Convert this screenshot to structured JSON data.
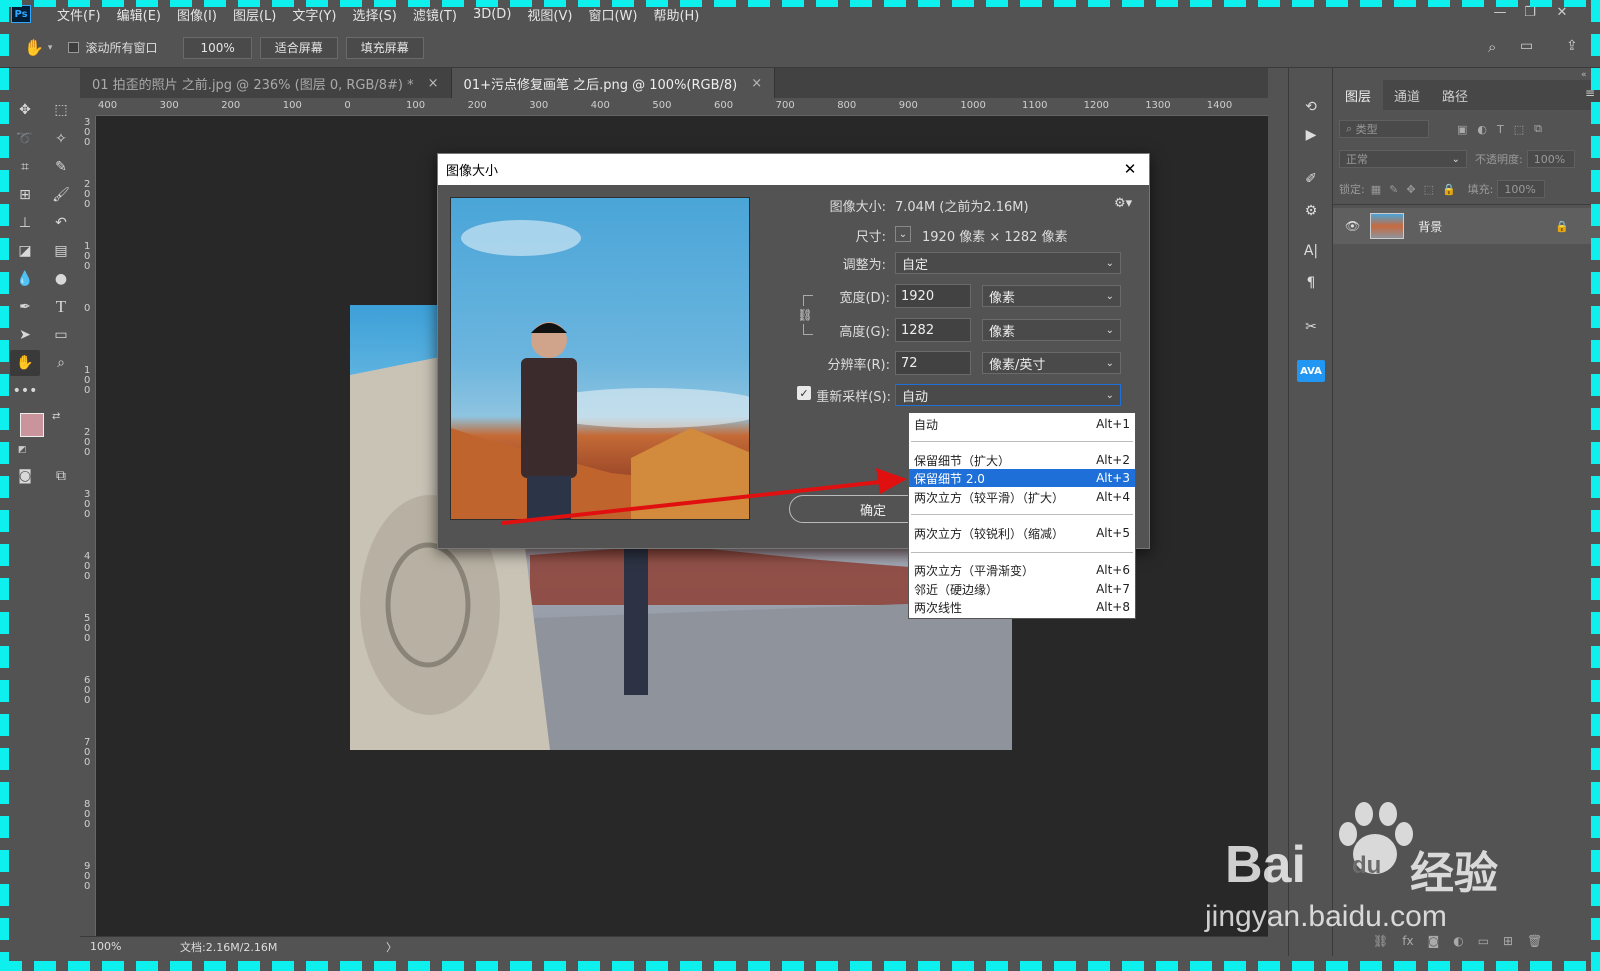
{
  "menubar": {
    "logo": "Ps",
    "items": [
      "文件(F)",
      "编辑(E)",
      "图像(I)",
      "图层(L)",
      "文字(Y)",
      "选择(S)",
      "滤镜(T)",
      "3D(D)",
      "视图(V)",
      "窗口(W)",
      "帮助(H)"
    ]
  },
  "options": {
    "scroll_all_label": "滚动所有窗口",
    "zoom_value": "100%",
    "fit_screen": "适合屏幕",
    "fill_screen": "填充屏幕"
  },
  "tabs": [
    {
      "label": "01 拍歪的照片 之前.jpg @ 236% (图层 0, RGB/8#) *",
      "close": "×"
    },
    {
      "label": "01+污点修复画笔 之后.png @ 100%(RGB/8)",
      "close": "×"
    }
  ],
  "ruler": {
    "top": [
      "400",
      "300",
      "200",
      "100",
      "0",
      "100",
      "200",
      "300",
      "400",
      "500",
      "600",
      "700",
      "800",
      "900",
      "1000",
      "1100",
      "1200",
      "1300",
      "1400"
    ],
    "left": [
      "3\n0\n0",
      "2\n0\n0",
      "1\n0\n0",
      "0",
      "1\n0\n0",
      "2\n0\n0",
      "3\n0\n0",
      "4\n0\n0",
      "5\n0\n0",
      "6\n0\n0",
      "7\n0\n0",
      "8\n0\n0",
      "9\n0\n0"
    ]
  },
  "status": {
    "zoom": "100%",
    "doc": "文档:2.16M/2.16M",
    "chevron": "〉"
  },
  "panel": {
    "tabs": [
      "图层",
      "通道",
      "路径"
    ],
    "filter_placeholder": "类型",
    "blend_mode": "正常",
    "opacity_label": "不透明度:",
    "opacity_value": "100%",
    "lock_label": "锁定:",
    "fill_label": "填充:",
    "fill_value": "100%",
    "layer_name": "背景",
    "ava_label": "AVA"
  },
  "dialog": {
    "title": "图像大小",
    "close": "✕",
    "size_label": "图像大小:",
    "size_value": "7.04M (之前为2.16M)",
    "dims_label": "尺寸:",
    "dims_value": "1920 像素  ×  1282 像素",
    "fit_label": "调整为:",
    "fit_value": "自定",
    "width_label": "宽度(D):",
    "width_value": "1920",
    "width_unit": "像素",
    "height_label": "高度(G):",
    "height_value": "1282",
    "height_unit": "像素",
    "res_label": "分辨率(R):",
    "res_value": "72",
    "res_unit": "像素/英寸",
    "resample_label": "重新采样(S):",
    "resample_value": "自动",
    "ok_label": "确定"
  },
  "dropdown": {
    "items": [
      {
        "label": "自动",
        "shortcut": "Alt+1",
        "selected": false
      },
      {
        "label": "保留细节（扩大）",
        "shortcut": "Alt+2",
        "selected": false
      },
      {
        "label": "保留细节 2.0",
        "shortcut": "Alt+3",
        "selected": true
      },
      {
        "label": "两次立方（较平滑）（扩大）",
        "shortcut": "Alt+4",
        "selected": false
      },
      {
        "label": "两次立方（较锐利）（缩减）",
        "shortcut": "Alt+5",
        "selected": false
      },
      {
        "label": "两次立方（平滑渐变）",
        "shortcut": "Alt+6",
        "selected": false
      },
      {
        "label": "邻近（硬边缘）",
        "shortcut": "Alt+7",
        "selected": false
      },
      {
        "label": "两次线性",
        "shortcut": "Alt+8",
        "selected": false
      }
    ]
  },
  "watermark": {
    "brand": "Bai",
    "du": "du",
    "cn": "经验",
    "url": "jingyan.baidu.com"
  },
  "colors": {
    "accent": "#1e6fd8",
    "arrow": "#e01010",
    "foreground_swatch": "#c9949c",
    "background_swatch": "#ffffff",
    "frame": "#0ef0ee"
  }
}
